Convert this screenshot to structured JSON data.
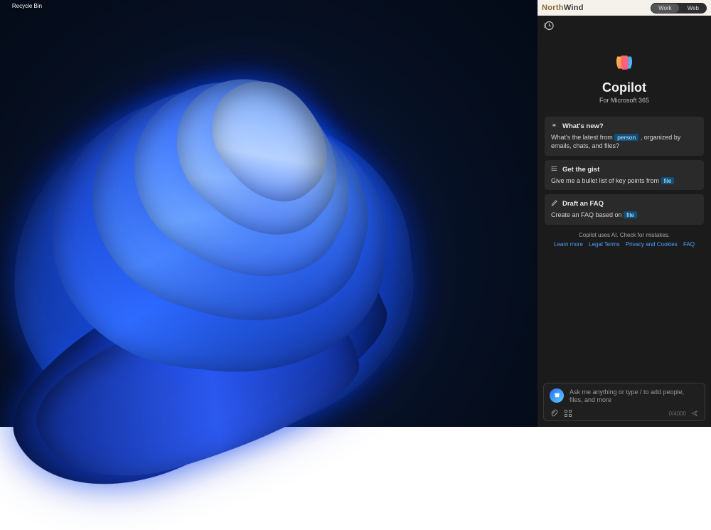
{
  "desktop": {
    "recycle_label": "Recycle Bin"
  },
  "copilot": {
    "brand_part1": "North",
    "brand_part2": "Wind",
    "tabs": {
      "work": "Work",
      "web": "Web",
      "active": "work"
    },
    "title": "Copilot",
    "subtitle": "For Microsoft 365",
    "cards": [
      {
        "icon": "sparkle-icon",
        "heading": "What's new?",
        "text_before": "What's the latest from ",
        "chip": "person",
        "text_after": " , organized by emails, chats, and files?"
      },
      {
        "icon": "list-icon",
        "heading": "Get the gist",
        "text_before": "Give me a bullet list of key points from ",
        "chip": "file",
        "text_after": ""
      },
      {
        "icon": "pencil-icon",
        "heading": "Draft an FAQ",
        "text_before": "Create an FAQ based on ",
        "chip": "file",
        "text_after": ""
      }
    ],
    "disclosure": "Copilot uses AI. Check for mistakes.",
    "links": [
      "Learn more",
      "Legal Terms",
      "Privacy and Cookies",
      "FAQ"
    ],
    "input": {
      "placeholder": "Ask me anything or type / to add people, files, and more",
      "counter": "0/4000"
    }
  }
}
